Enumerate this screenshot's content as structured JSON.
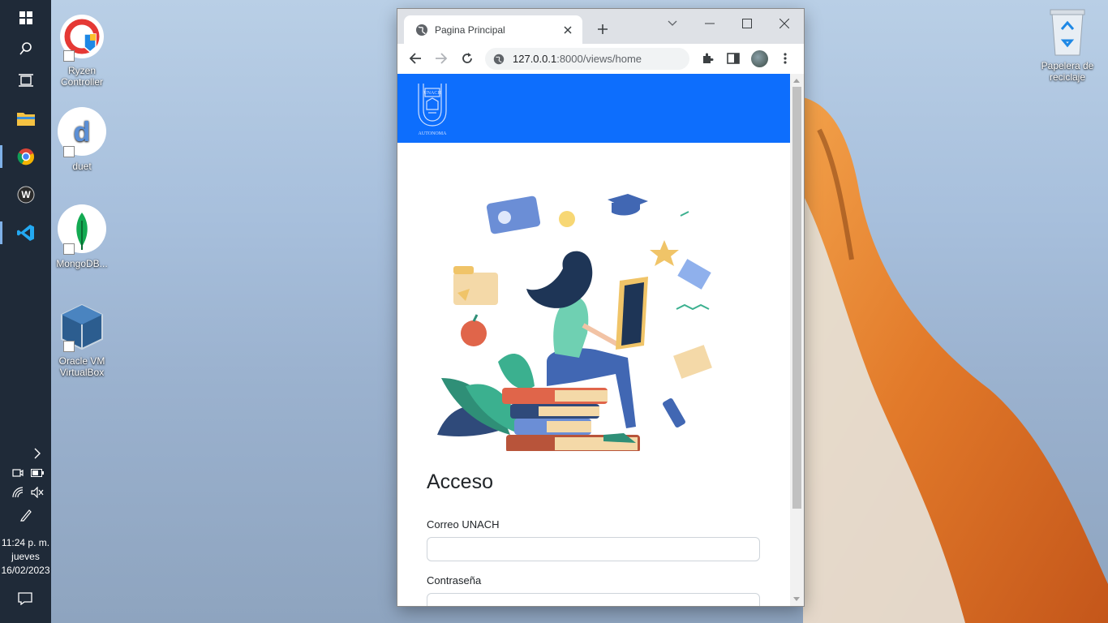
{
  "taskbar": {
    "icons": [
      "windows-start-icon",
      "search-icon",
      "task-view-icon",
      "file-explorer-icon",
      "chrome-icon",
      "wondershare-icon",
      "vscode-icon"
    ],
    "tray": [
      "chevron-right-icon",
      "meet-now-icon",
      "battery-icon",
      "network-icon",
      "volume-muted-icon",
      "pen-icon"
    ],
    "clock_time": "11:24 p. m.",
    "clock_day": "jueves",
    "clock_date": "16/02/2023",
    "notification_icon": "action-center-icon"
  },
  "desktop": {
    "icons": [
      {
        "label": "Ryzen Controller",
        "icon": "ryzen-controller-icon"
      },
      {
        "label": "duet",
        "icon": "duet-icon"
      },
      {
        "label": "MongoDB...",
        "icon": "mongodb-icon"
      },
      {
        "label": "Oracle VM VirtualBox",
        "icon": "virtualbox-icon"
      }
    ],
    "recycle_bin": "Papelera de reciclaje"
  },
  "browser": {
    "tab_title": "Pagina Principal",
    "url_host": "127.0.0.1",
    "url_path": ":8000/views/home"
  },
  "page": {
    "brand_color": "#0d6efd",
    "form_title": "Acceso",
    "email_label": "Correo UNACH",
    "email_value": "",
    "password_label": "Contraseña",
    "password_value": ""
  }
}
